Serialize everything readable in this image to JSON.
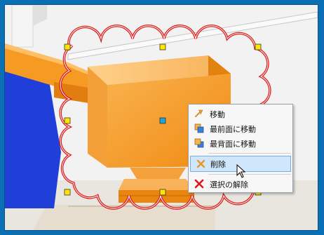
{
  "context_menu": {
    "items": [
      {
        "label": "移動",
        "icon": "move-arrow-icon"
      },
      {
        "label": "最前面に移動",
        "icon": "bring-to-front-icon"
      },
      {
        "label": "最背面に移動",
        "icon": "send-to-back-icon"
      },
      {
        "label": "削除",
        "icon": "delete-icon",
        "highlighted": true
      },
      {
        "label": "選択の解除",
        "icon": "deselect-x-icon"
      }
    ]
  },
  "colors": {
    "accent_orange": "#f5a43a",
    "cloud_outline_red": "#e01818",
    "handle_yellow": "#ffe600",
    "center_handle_cyan": "#1aa7d6",
    "blue_object": "#1f3fd8",
    "menu_highlight": "#cfe6fb"
  }
}
